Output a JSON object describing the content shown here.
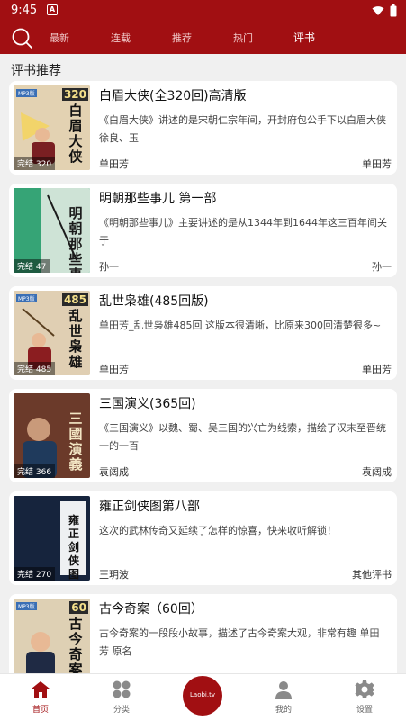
{
  "status": {
    "time": "9:45"
  },
  "nav": {
    "tabs": [
      "最新",
      "连载",
      "推荐",
      "热门",
      "评书"
    ]
  },
  "section": {
    "title": "评书推荐"
  },
  "books": [
    {
      "title": "白眉大侠(全320回)高清版",
      "desc": "《白眉大侠》讲述的是宋朝仁宗年间，开封府包公手下以白眉大侠徐良、玉",
      "author": "单田芳",
      "tag": "单田芳",
      "badge": "完结 320",
      "cover_num": "320",
      "cover_title": "白眉大侠",
      "cover_color": "#d7c3a1"
    },
    {
      "title": "明朝那些事儿 第一部",
      "desc": "《明朝那些事儿》主要讲述的是从1344年到1644年这三百年间关于",
      "author": "孙一",
      "tag": "孙一",
      "badge": "完结 47",
      "cover_num": "",
      "cover_title": "明朝那些事儿",
      "cover_color": "#2f9a6f"
    },
    {
      "title": "乱世枭雄(485回版)",
      "desc": "单田芳_乱世枭雄485回 这版本很清晰，比原来300回清楚很多~",
      "author": "单田芳",
      "tag": "单田芳",
      "badge": "完结 485",
      "cover_num": "485",
      "cover_title": "乱世枭雄",
      "cover_color": "#d9c9b0"
    },
    {
      "title": "三国演义(365回)",
      "desc": "《三国演义》以魏、蜀、吴三国的兴亡为线索，描绘了汉末至晋统一的一百",
      "author": "袁阔成",
      "tag": "袁阔成",
      "badge": "完结 366",
      "cover_num": "",
      "cover_title": "三國演義",
      "cover_color": "#6b3a2a"
    },
    {
      "title": "雍正剑侠图第八部",
      "desc": "这次的武林传奇又延续了怎样的惊喜，快来收听解锁！",
      "author": "王玥波",
      "tag": "其他评书",
      "badge": "完结 270",
      "cover_num": "",
      "cover_title": "雍正剑侠图",
      "cover_color": "#1a2a44"
    },
    {
      "title": "古今奇案（60回）",
      "desc": "古今奇案的一段段小故事，描述了古今奇案大观，非常有趣 单田芳 原名",
      "author": "",
      "tag": "",
      "badge": "",
      "cover_num": "60",
      "cover_title": "古今奇案",
      "cover_color": "#d8c7a6"
    }
  ],
  "bottom_nav": {
    "home": "首页",
    "category": "分类",
    "center": "Laobi.tv",
    "mine": "我的",
    "settings": "设置"
  },
  "colors": {
    "brand": "#a10f12"
  }
}
